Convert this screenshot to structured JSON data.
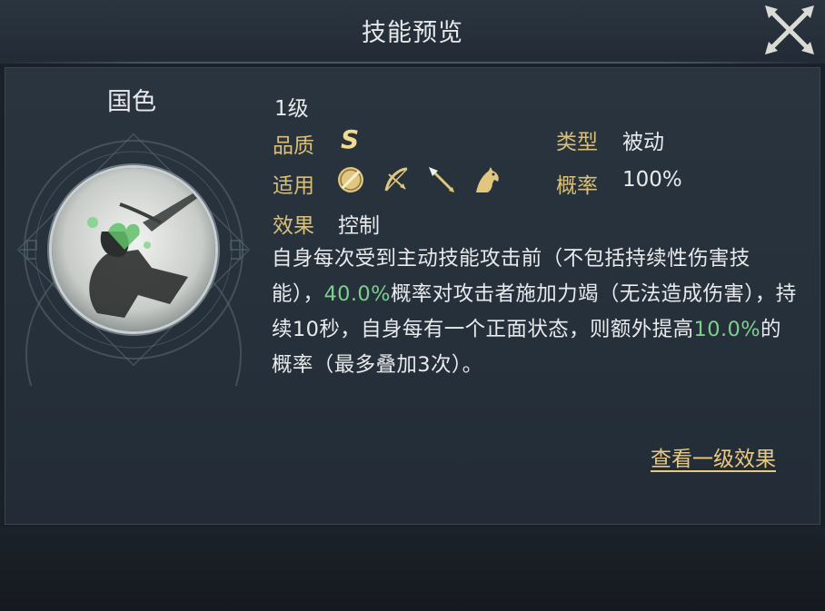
{
  "dialog": {
    "title": "技能预览"
  },
  "skill": {
    "name": "国色",
    "level": "1级",
    "quality_label": "品质",
    "quality_value": "S",
    "type_label": "类型",
    "type_value": "被动",
    "applicable_label": "适用",
    "applicable_icons": [
      "shield-unit-icon",
      "bow-unit-icon",
      "spear-unit-icon",
      "cavalry-horse-icon"
    ],
    "rate_label": "概率",
    "rate_value": "100%",
    "effect_label": "效果",
    "effect_value": "控制",
    "description": {
      "part1": "自身每次受到主动技能攻击前（不包括持续性伤害技能），",
      "hl1": "40.0%",
      "part2": "概率对攻击者施加力竭（无法造成伤害），持续10秒，自身每有一个正面状态，则额外提高",
      "hl2": "10.0%",
      "part3": "的概率（最多叠加3次）。"
    },
    "view_level_one_link": "查看一级效果"
  },
  "colors": {
    "highlight": "#7ccf8e",
    "label_gold": "#d8c07a",
    "link_gold": "#e8c980"
  }
}
